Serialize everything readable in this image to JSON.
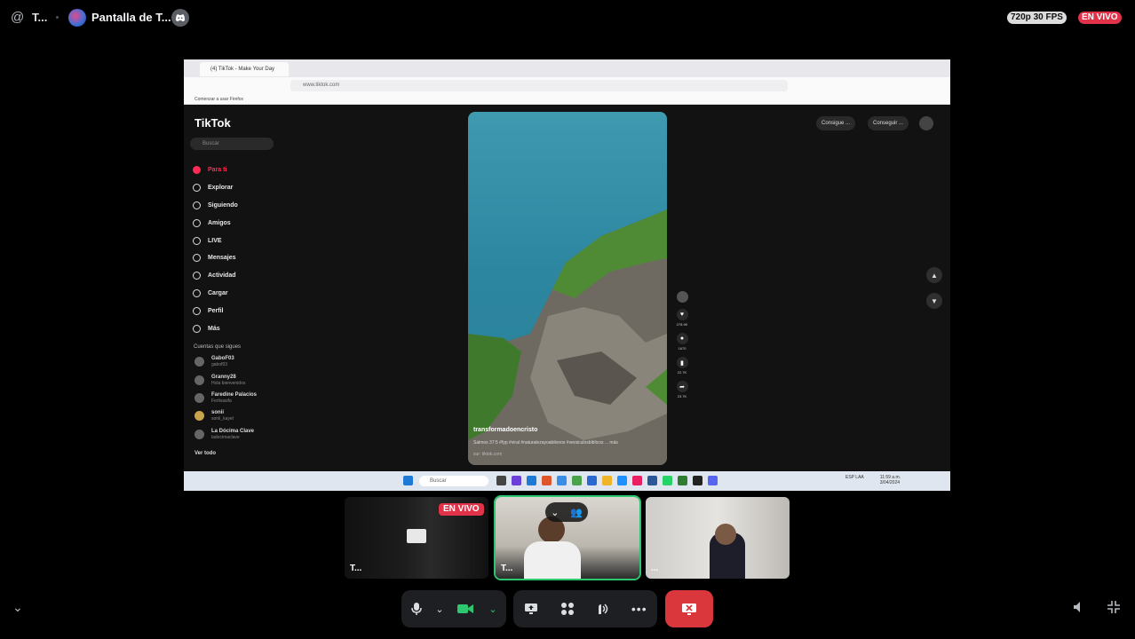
{
  "top_bar": {
    "channel_icon": "at-icon",
    "channel_name": "T...",
    "stream_name": "Pantalla de T...",
    "platform_icon": "discord-icon",
    "quality": "720p 30 FPS",
    "live": "EN VIVO"
  },
  "browser": {
    "tab_title": "(4) TikTok - Make Your Day",
    "url": "www.tiktok.com",
    "bookmark": "Comenzar a usar Firefox"
  },
  "tiktok": {
    "logo": "TikTok",
    "search_placeholder": "Buscar",
    "nav": [
      "Para ti",
      "Explorar",
      "Siguiendo",
      "Amigos",
      "LIVE",
      "Mensajes",
      "Actividad",
      "Cargar",
      "Perfil",
      "Más"
    ],
    "following_header": "Cuentas que sigues",
    "accounts": [
      {
        "name": "GaboF03",
        "handle": "gabof03"
      },
      {
        "name": "Granny28",
        "handle": "Hola bienvenidos"
      },
      {
        "name": "Faredine Palacios",
        "handle": "Ferlivasifa"
      },
      {
        "name": "sonii",
        "handle": "sonii_kayel"
      },
      {
        "name": "La Dócima Clave",
        "handle": "ladocimaclave"
      }
    ],
    "see_all": "Ver todo",
    "top_buttons": [
      "Consigue ...",
      "Conseguir ..."
    ],
    "video": {
      "title": "transformadoencristo",
      "description": "Salmos 37:5 #fyp #viral #naturalezayoabilonos #versiculosbiblicos ... más",
      "music": "sur: tiktok.com"
    },
    "actions": [
      {
        "icon": "heart-icon",
        "count": "278.9K"
      },
      {
        "icon": "comment-icon",
        "count": "1670"
      },
      {
        "icon": "bookmark-icon",
        "count": "22.7K"
      },
      {
        "icon": "share-icon",
        "count": "23.7K"
      }
    ]
  },
  "taskbar": {
    "search": "Buscar",
    "lang": "ESP LAA",
    "time": "11:59 a.m.",
    "date": "3/04/2024"
  },
  "participants": [
    {
      "label": "T...",
      "live": "EN VIVO"
    },
    {
      "label": "T..."
    },
    {
      "label": "..."
    }
  ],
  "controls": {
    "mic": "mic-icon",
    "camera": "camera-icon",
    "share": "screen-share-icon",
    "activities": "activities-icon",
    "soundboard": "soundboard-icon",
    "more": "more-icon",
    "end": "end-stream-icon"
  }
}
